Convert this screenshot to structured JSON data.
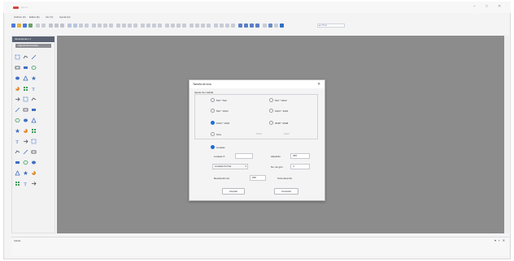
{
  "app": {
    "title": "Ipnom",
    "window_controls": {
      "minimize": "–",
      "maximize": "□",
      "close": "✕"
    }
  },
  "menu": [
    "Archivo (F)",
    "Editar (E)",
    "Ver (V)",
    "Ayuda (H)"
  ],
  "toolbar": {
    "combo_value": "■ 1 Píxel"
  },
  "tool_panel": {
    "header": "Herramientas ▾ ✕",
    "subheader": "Caja de herramientas",
    "tools": [
      "select-icon",
      "lasso-icon",
      "line-icon",
      "pencil-icon",
      "curve-icon",
      "polyline-icon",
      "rectangle-icon",
      "filled-rectangle-icon",
      "rounded-rectangle-icon",
      "ellipse-icon",
      "filled-ellipse-icon",
      "arc-icon",
      "triangle-icon",
      "star-icon",
      "pie-icon",
      "brush-icon",
      "circle-icon",
      "spray-icon",
      "pen-icon",
      "text-icon",
      "grid-icon",
      "image-icon",
      "diagonal-icon",
      "gradient-icon",
      "table-icon",
      "symbol-icon",
      "flag-icon",
      "move-icon",
      "rotate-icon",
      "fill-icon",
      "shape-icon",
      "arrow-icon",
      "polygon-icon",
      "arrow-right-icon",
      "grid-small-icon",
      "layers-icon",
      "stamp-icon",
      "grid-large-icon",
      "tile-icon"
    ]
  },
  "bottom_panel": {
    "label": "Salida",
    "controls": "▾ ▪ ✕"
  },
  "dialog": {
    "title": "Tamaño de lona",
    "close": "✕",
    "group_label": "Ajuste de medida",
    "options": [
      {
        "label": "512 * 512",
        "selected": false
      },
      {
        "label": "512 * 1024",
        "selected": false
      },
      {
        "label": "512 * 1024",
        "selected": false
      },
      {
        "label": "1024 * 1024",
        "selected": false
      },
      {
        "label": "1024 * 1024",
        "selected": true
      },
      {
        "label": "2048 * 2048",
        "selected": false
      },
      {
        "label": "Otra",
        "selected": false
      }
    ],
    "other_width_hint": "1024",
    "other_height_hint": "1024",
    "tiling_option": {
      "label": "Losetas",
      "selected": true
    },
    "fields": {
      "tile_width_label": "Losetas X",
      "tile_width_value": "",
      "tile_height_label": "Alquitrán",
      "tile_height_value": "256",
      "tile_shape_value": "Losetas Forma",
      "tile_count_label": "No. de giro",
      "tile_count_value": "4",
      "resolution_label": "Resolución de",
      "resolution_value": "256",
      "extra_label": "Todo derecho"
    },
    "ok_label": "Aceptar",
    "cancel_label": "Cancelar"
  }
}
